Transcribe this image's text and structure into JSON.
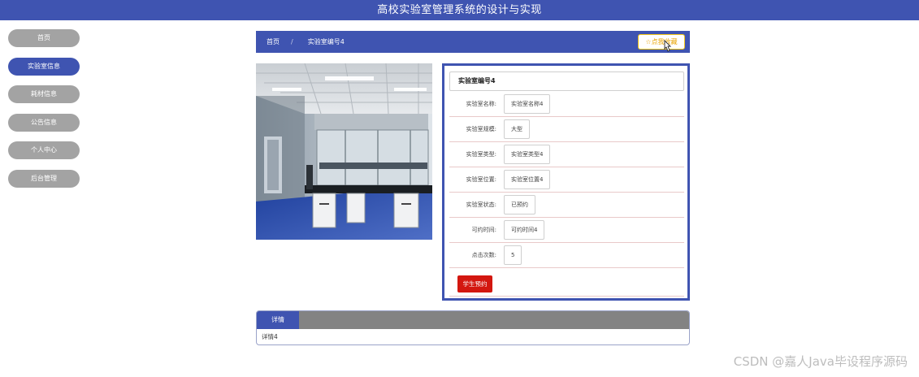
{
  "header": {
    "title": "高校实验室管理系统的设计与实现"
  },
  "sidebar": {
    "items": [
      {
        "label": "首页",
        "active": false
      },
      {
        "label": "实验室信息",
        "active": true
      },
      {
        "label": "耗材信息",
        "active": false
      },
      {
        "label": "公告信息",
        "active": false
      },
      {
        "label": "个人中心",
        "active": false
      },
      {
        "label": "后台管理",
        "active": false
      }
    ]
  },
  "breadcrumb": {
    "home": "首页",
    "separator": "/",
    "current": "实验室编号4",
    "favorite_label": "☆点我收藏"
  },
  "detail": {
    "title": "实验室编号4",
    "fields": [
      {
        "label": "实验室名称:",
        "value": "实验室名称4"
      },
      {
        "label": "实验室规模:",
        "value": "大型"
      },
      {
        "label": "实验室类型:",
        "value": "实验室类型4"
      },
      {
        "label": "实验室位置:",
        "value": "实验室位置4"
      },
      {
        "label": "实验室状态:",
        "value": "已预约"
      },
      {
        "label": "可约时间:",
        "value": "可约时间4"
      },
      {
        "label": "点击次数:",
        "value": "5"
      }
    ],
    "reserve_label": "学生预约"
  },
  "tabs": {
    "active_label": "详情",
    "content": "详情4"
  },
  "watermark": "CSDN @嘉人Java毕设程序源码",
  "colors": {
    "primary": "#3f54b1",
    "sidebar_inactive": "#a3a3a3",
    "reserve": "#d3170f",
    "favorite": "#e8a400"
  }
}
